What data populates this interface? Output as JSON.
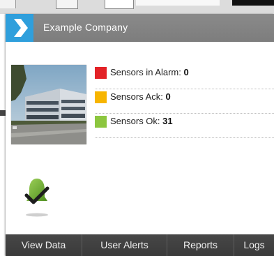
{
  "header": {
    "company_name": "Example Company",
    "logo_icon": "chevron-right-icon",
    "accent": "#2f9fdc"
  },
  "site_photo": {
    "icon": "building-photo"
  },
  "statuses": [
    {
      "label": "Sensors in Alarm:",
      "count": "0",
      "color": "#e32227"
    },
    {
      "label": "Sensors Ack:",
      "count": "0",
      "color": "#f7b500"
    },
    {
      "label": "Sensors Ok:",
      "count": "31",
      "color": "#8cc63f"
    }
  ],
  "overall_status_icon": "alarm-checkmark-icon",
  "footer_tabs": [
    {
      "label": "View Data"
    },
    {
      "label": "User Alerts"
    },
    {
      "label": "Reports"
    },
    {
      "label": "Logs"
    }
  ]
}
